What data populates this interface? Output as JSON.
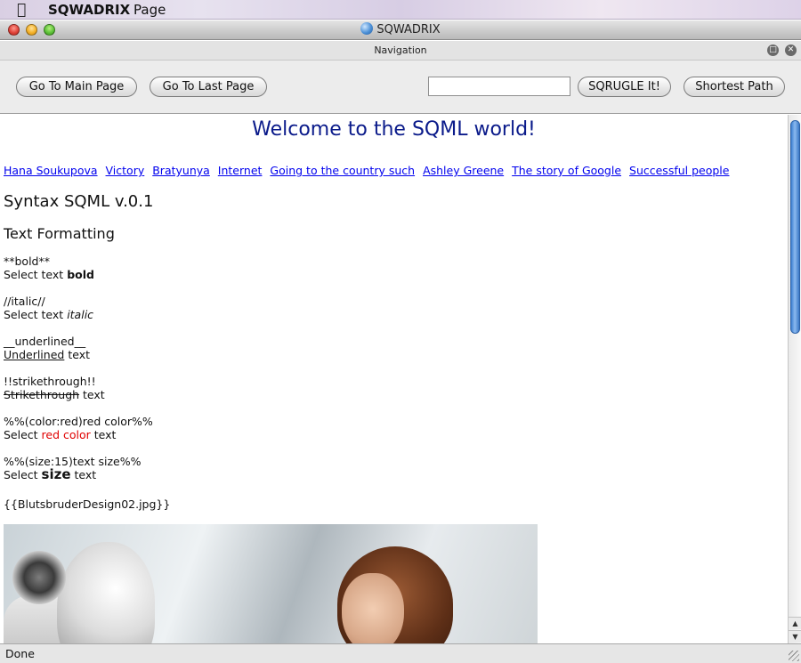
{
  "menubar": {
    "app_name": "SQWADRIX",
    "menu_page": "Page",
    "apple_icon": "apple-logo-icon"
  },
  "window": {
    "title": "SQWADRIX",
    "title_icon": "globe-icon"
  },
  "navigation": {
    "title": "Navigation",
    "go_main": "Go To Main Page",
    "go_last": "Go To Last Page",
    "search_value": "",
    "search_button": "SQRUGLE It!",
    "shortest_path": "Shortest Path"
  },
  "content": {
    "heading": "Welcome to the SQML world!",
    "heading_color": "#0a1a8a",
    "links": [
      "Hana Soukupova",
      "Victory",
      "Bratyunya",
      "Internet",
      "Going to the country such",
      "Ashley Greene",
      "The story of Google",
      "Successful people"
    ],
    "syntax_heading": "Syntax SQML v.0.1",
    "formatting_heading": "Text Formatting",
    "bold": {
      "code": "**bold**",
      "prefix": "Select text ",
      "sample": "bold"
    },
    "italic": {
      "code": "//italic//",
      "prefix": "Select text ",
      "sample": "italic"
    },
    "underline": {
      "code": "__underlined__",
      "sample": "Underlined",
      "suffix": " text"
    },
    "strike": {
      "code": "!!strikethrough!!",
      "sample": "Strikethrough",
      "suffix": " text"
    },
    "color": {
      "code": "%%(color:red)red color%%",
      "prefix": "Select ",
      "sample": "red color",
      "suffix": " text",
      "sample_color": "#e00000"
    },
    "size": {
      "code": "%%(size:15)text size%%",
      "prefix": "Select ",
      "sample": "size",
      "suffix": " text"
    },
    "image_code": "{{BlutsbruderDesign02.jpg}}"
  },
  "status": {
    "text": "Done"
  }
}
